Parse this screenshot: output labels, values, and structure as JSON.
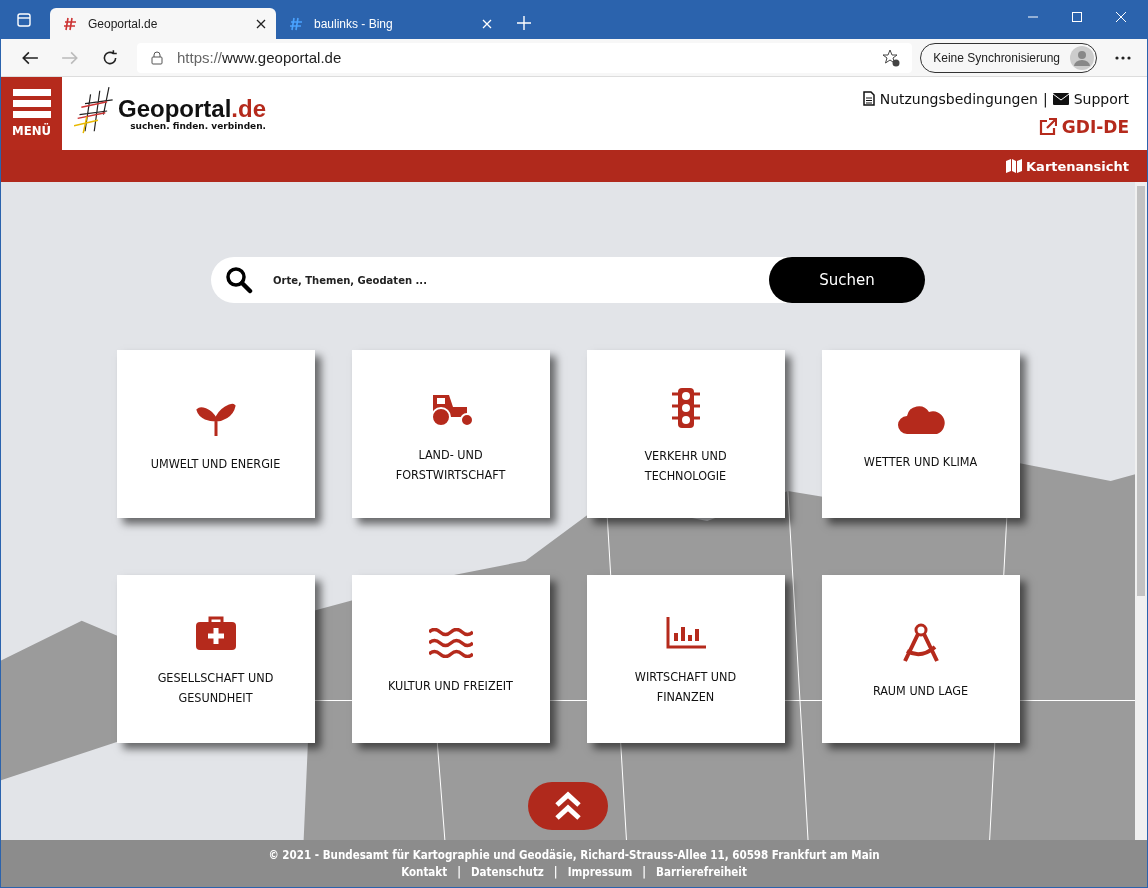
{
  "browser": {
    "tabs": [
      {
        "title": "Geoportal.de",
        "selected": true
      },
      {
        "title": "baulinks - Bing",
        "selected": false
      }
    ],
    "url_prefix": "https://",
    "url_host": "www.geoportal.de",
    "profile": "Keine Synchronisierung"
  },
  "header": {
    "menu": "MENÜ",
    "logo_main": "Geoportal",
    "logo_suffix": ".de",
    "tagline": "suchen. finden. verbinden.",
    "links": [
      "Nutzungsbedingungen",
      "Support"
    ],
    "separator": "|",
    "gdi": "GDI-DE",
    "map_view": "Kartenansicht"
  },
  "search": {
    "placeholder": "Orte, Themen, Geodaten ...",
    "button": "Suchen"
  },
  "tiles": [
    {
      "kind": "plant",
      "label": "UMWELT UND ENERGIE"
    },
    {
      "kind": "tractor",
      "label": "LAND- UND FORSTWIRTSCHAFT"
    },
    {
      "kind": "traffic",
      "label": "VERKEHR UND TECHNOLOGIE"
    },
    {
      "kind": "cloud",
      "label": "WETTER UND KLIMA"
    },
    {
      "kind": "medkit",
      "label": "GESELLSCHAFT UND GESUNDHEIT"
    },
    {
      "kind": "waves",
      "label": "KULTUR UND FREIZEIT"
    },
    {
      "kind": "chart",
      "label": "WIRTSCHAFT UND FINANZEN"
    },
    {
      "kind": "compass",
      "label": "RAUM UND LAGE"
    }
  ],
  "footer": {
    "copyright": "© 2021 - Bundesamt für Kartographie und Geodäsie, Richard-Strauss-Allee 11, 60598 Frankfurt am Main",
    "links": [
      "Kontakt",
      "Datenschutz",
      "Impressum",
      "Barrierefreiheit"
    ],
    "separator": "|"
  }
}
